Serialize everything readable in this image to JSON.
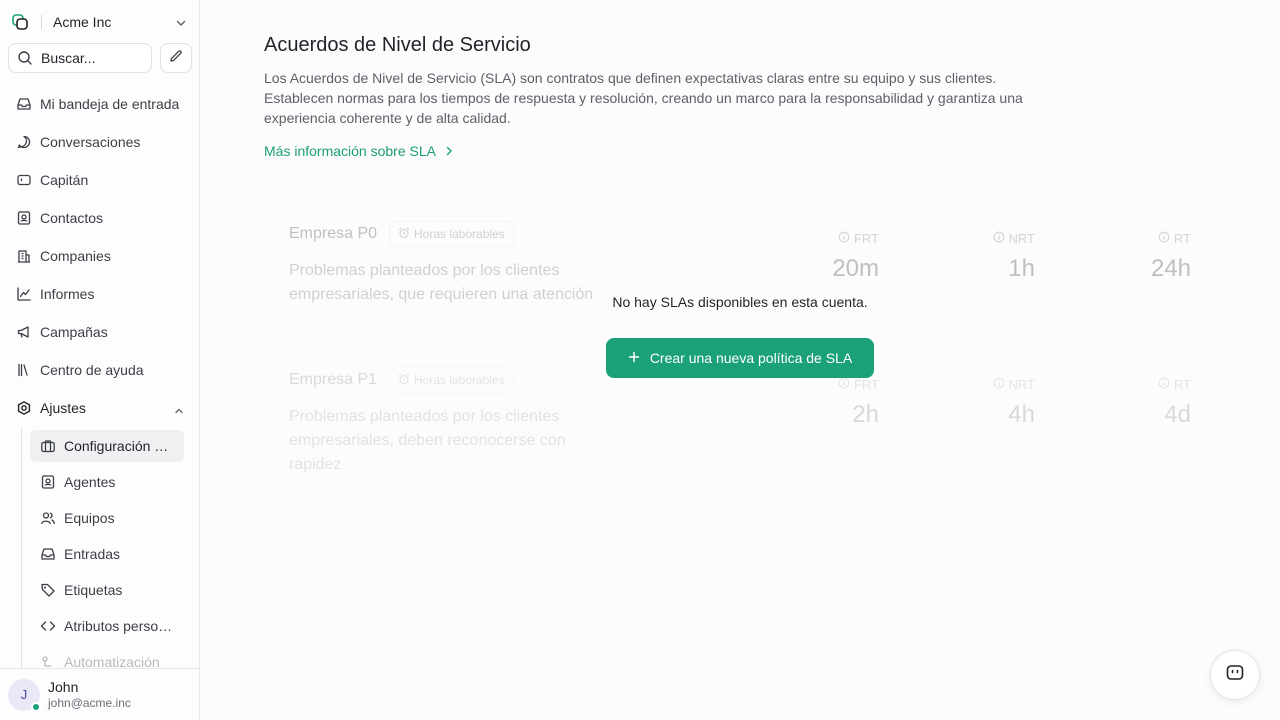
{
  "account": {
    "name": "Acme Inc"
  },
  "search": {
    "placeholder": "Buscar..."
  },
  "nav": {
    "items": [
      {
        "label": "Mi bandeja de entrada",
        "icon": "inbox-icon"
      },
      {
        "label": "Conversaciones",
        "icon": "chat-bubble-icon"
      },
      {
        "label": "Capitán",
        "icon": "robot-icon"
      },
      {
        "label": "Contactos",
        "icon": "contact-card-icon"
      },
      {
        "label": "Companies",
        "icon": "building-icon"
      },
      {
        "label": "Informes",
        "icon": "line-chart-icon"
      },
      {
        "label": "Campañas",
        "icon": "megaphone-icon"
      },
      {
        "label": "Centro de ayuda",
        "icon": "library-icon"
      }
    ],
    "settings_label": "Ajustes",
    "settings_items": [
      {
        "label": "Configuración de la cuenta",
        "icon": "briefcase-icon"
      },
      {
        "label": "Agentes",
        "icon": "agent-icon"
      },
      {
        "label": "Equipos",
        "icon": "team-icon"
      },
      {
        "label": "Entradas",
        "icon": "inbox-icon"
      },
      {
        "label": "Etiquetas",
        "icon": "tag-icon"
      },
      {
        "label": "Atributos personalizados",
        "icon": "code-icon"
      },
      {
        "label": "Automatización",
        "icon": "automation-icon"
      }
    ]
  },
  "user": {
    "initial": "J",
    "name": "John",
    "email": "john@acme.inc"
  },
  "page": {
    "title": "Acuerdos de Nivel de Servicio",
    "description": "Los Acuerdos de Nivel de Servicio (SLA) son contratos que definen expectativas claras entre su equipo y sus clientes. Establecen normas para los tiempos de respuesta y resolución, creando un marco para la responsabilidad y garantiza una experiencia coherente y de alta calidad.",
    "learn_more": "Más información sobre SLA"
  },
  "sample_slas": [
    {
      "name": "Empresa P0",
      "badge": "Horas laborables",
      "description": "Problemas planteados por los clientes empresariales, que requieren una atención",
      "metrics": [
        {
          "label": "FRT",
          "value": "20m"
        },
        {
          "label": "NRT",
          "value": "1h"
        },
        {
          "label": "RT",
          "value": "24h"
        }
      ]
    },
    {
      "name": "Empresa P1",
      "badge": "Horas laborables",
      "description": "Problemas planteados por los clientes empresariales, deben reconocerse con rapidez",
      "metrics": [
        {
          "label": "FRT",
          "value": "2h"
        },
        {
          "label": "NRT",
          "value": "4h"
        },
        {
          "label": "RT",
          "value": "4d"
        }
      ]
    }
  ],
  "empty_state": {
    "message": "No hay SLAs disponibles en esta cuenta.",
    "cta_label": "Crear una nueva política de SLA"
  },
  "colors": {
    "accent": "#1aa179",
    "link": "#1a9e74"
  }
}
